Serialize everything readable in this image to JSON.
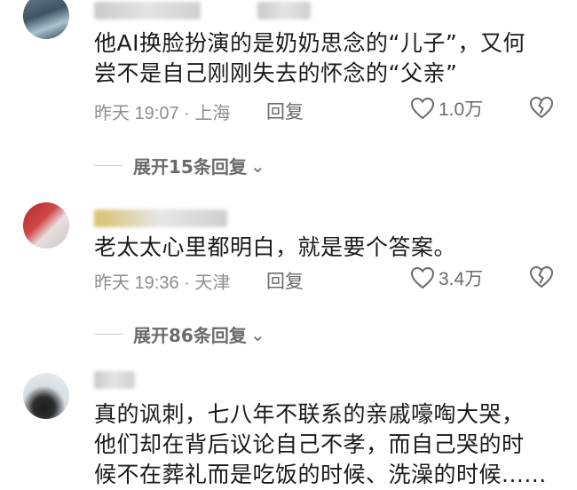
{
  "comments": [
    {
      "text_lines": [
        "他AI换脸扮演的是奶奶思念的“儿子”，又何",
        "尝不是自己刚刚失去的怀念的“父亲”"
      ],
      "time_location": "昨天 19:07 · 上海",
      "reply_label": "回复",
      "likes": "1.0万",
      "expand_label": "展开15条回复"
    },
    {
      "text_lines": [
        "老太太心里都明白，就是要个答案。"
      ],
      "time_location": "昨天 19:36 · 天津",
      "reply_label": "回复",
      "likes": "3.4万",
      "expand_label": "展开86条回复"
    },
    {
      "text_lines": [
        "真的讽刺，七八年不联系的亲戚嚎啕大哭，",
        "他们却在背后议论自己不孝，而自己哭的时",
        "候不在葬礼而是吃饭的时候、洗澡的时候......"
      ]
    }
  ],
  "icons": {
    "heart": "heart-outline-icon",
    "dislike": "broken-heart-icon",
    "chevron": "chevron-down-icon"
  },
  "colors": {
    "text": "#1a1a1a",
    "meta": "#8e8e8e",
    "action": "#6b6b6b"
  }
}
